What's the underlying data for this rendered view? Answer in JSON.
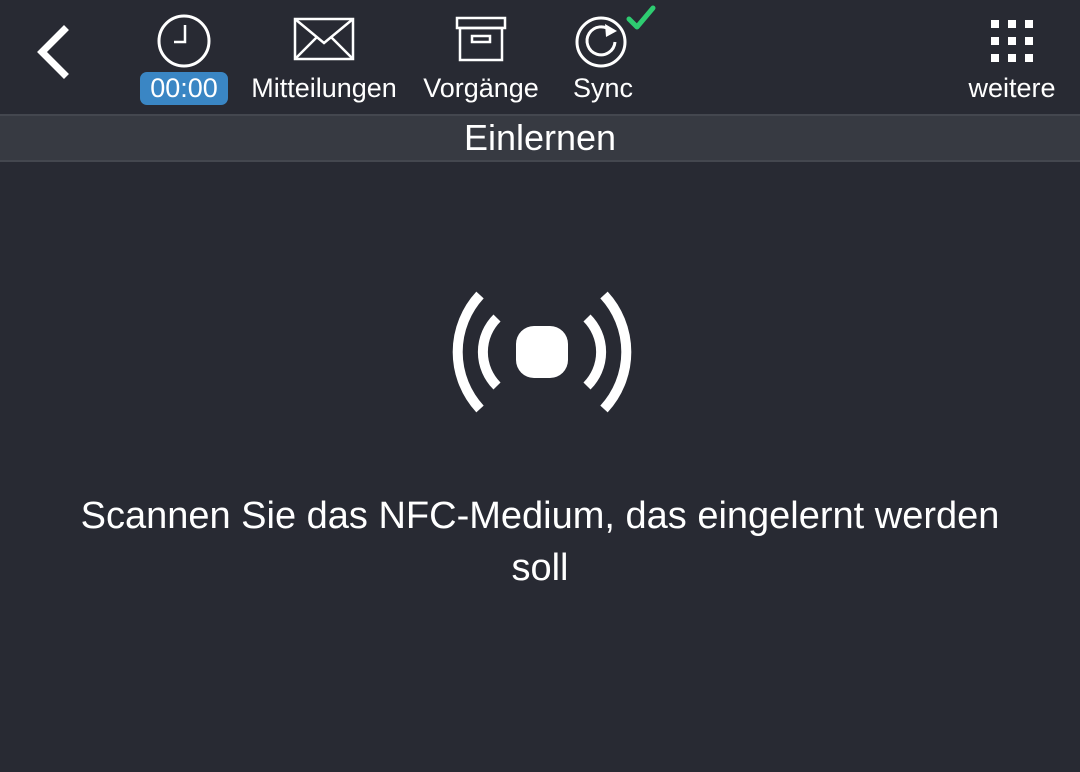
{
  "toolbar": {
    "items": [
      {
        "name": "time",
        "icon": "clock-icon",
        "label": "00:00"
      },
      {
        "name": "messages",
        "icon": "envelope-icon",
        "label": "Mitteilungen"
      },
      {
        "name": "processes",
        "icon": "archive-box-icon",
        "label": "Vorgänge"
      },
      {
        "name": "sync",
        "icon": "sync-icon",
        "label": "Sync",
        "status_icon": "checkmark-icon",
        "status_color": "#2ecc71"
      },
      {
        "name": "more",
        "icon": "grid-icon",
        "label": "weitere"
      }
    ],
    "badge_color": "#3a86c4"
  },
  "title_bar": {
    "title": "Einlernen"
  },
  "main": {
    "icon": "nfc-signal-icon",
    "message": "Scannen Sie das NFC-Medium, das eingelernt werden soll"
  },
  "colors": {
    "background": "#282a33",
    "title_bar": "#373a42"
  }
}
